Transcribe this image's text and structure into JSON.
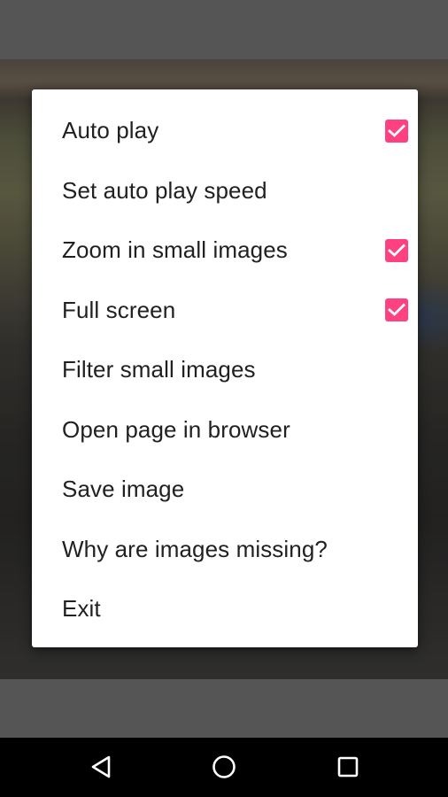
{
  "colors": {
    "accent": "#ff4081",
    "menu_text": "#212121",
    "menu_background": "#ffffff",
    "nav_bar": "#000000",
    "scrim": "#555555"
  },
  "menu": {
    "items": [
      {
        "label": "Auto play",
        "has_checkbox": true,
        "checked": true
      },
      {
        "label": "Set auto play speed",
        "has_checkbox": false
      },
      {
        "label": "Zoom in small images",
        "has_checkbox": true,
        "checked": true
      },
      {
        "label": "Full screen",
        "has_checkbox": true,
        "checked": true
      },
      {
        "label": "Filter small images",
        "has_checkbox": false
      },
      {
        "label": "Open page in browser",
        "has_checkbox": false
      },
      {
        "label": "Save image",
        "has_checkbox": false
      },
      {
        "label": "Why are images missing?",
        "has_checkbox": false
      },
      {
        "label": "Exit",
        "has_checkbox": false
      }
    ]
  },
  "nav_bar": {
    "buttons": [
      {
        "name": "back",
        "icon": "back-triangle-icon"
      },
      {
        "name": "home",
        "icon": "home-circle-icon"
      },
      {
        "name": "recents",
        "icon": "recents-square-icon"
      }
    ]
  }
}
